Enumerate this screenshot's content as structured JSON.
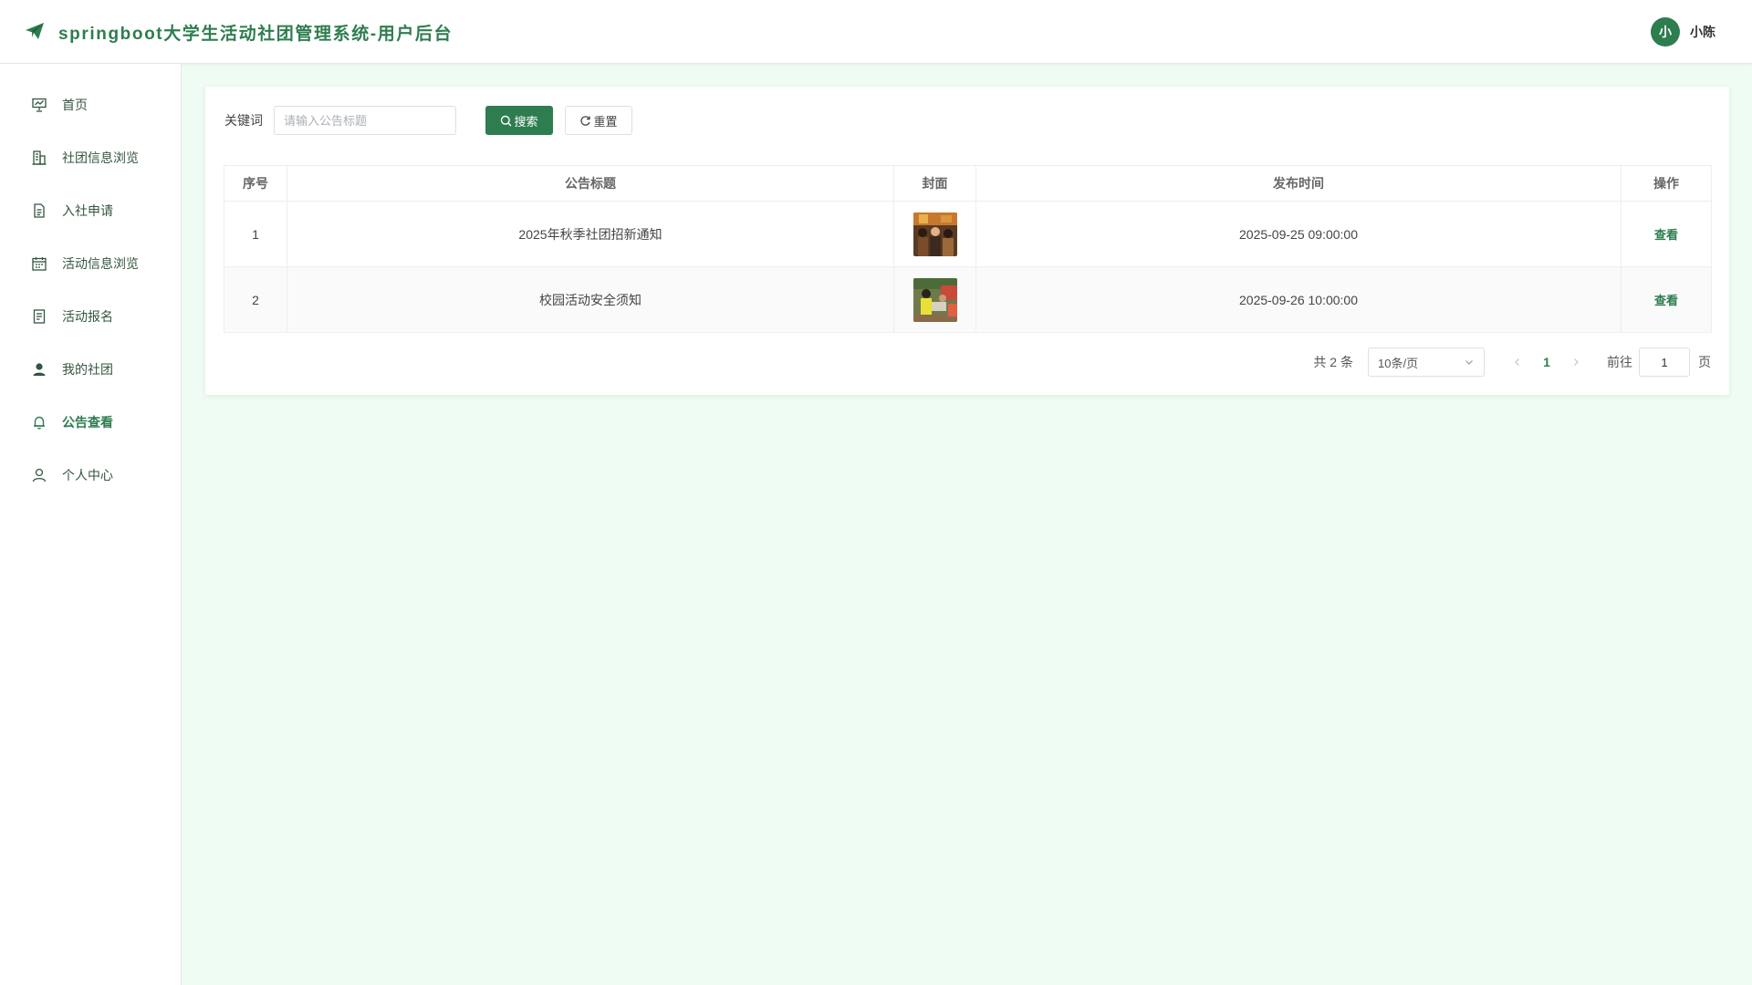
{
  "header": {
    "title": "springboot大学生活动社团管理系统-用户后台",
    "user": {
      "avatar_text": "小",
      "name": "小陈"
    }
  },
  "sidebar": {
    "items": [
      {
        "label": "首页",
        "icon": "presentation-chart-icon",
        "active": false
      },
      {
        "label": "社团信息浏览",
        "icon": "building-icon",
        "active": false
      },
      {
        "label": "入社申请",
        "icon": "document-icon",
        "active": false
      },
      {
        "label": "活动信息浏览",
        "icon": "calendar-icon",
        "active": false
      },
      {
        "label": "活动报名",
        "icon": "form-icon",
        "active": false
      },
      {
        "label": "我的社团",
        "icon": "user-filled-icon",
        "active": false
      },
      {
        "label": "公告查看",
        "icon": "bell-icon",
        "active": true
      },
      {
        "label": "个人中心",
        "icon": "user-icon",
        "active": false
      }
    ]
  },
  "search": {
    "label": "关键词",
    "placeholder": "请输入公告标题",
    "value": "",
    "search_label": "搜索",
    "reset_label": "重置"
  },
  "table": {
    "columns": [
      "序号",
      "公告标题",
      "封面",
      "发布时间",
      "操作"
    ],
    "rows": [
      {
        "index": "1",
        "title": "2025年秋季社团招新通知",
        "published": "2025-09-25 09:00:00",
        "action": "查看"
      },
      {
        "index": "2",
        "title": "校园活动安全须知",
        "published": "2025-09-26 10:00:00",
        "action": "查看"
      }
    ]
  },
  "pagination": {
    "total_text": "共 2 条",
    "page_size": "10条/页",
    "current_page": "1",
    "goto_label": "前往",
    "goto_value": "1",
    "goto_suffix": "页"
  },
  "colors": {
    "accent": "#2e7d4f",
    "background": "#eefcf3"
  }
}
